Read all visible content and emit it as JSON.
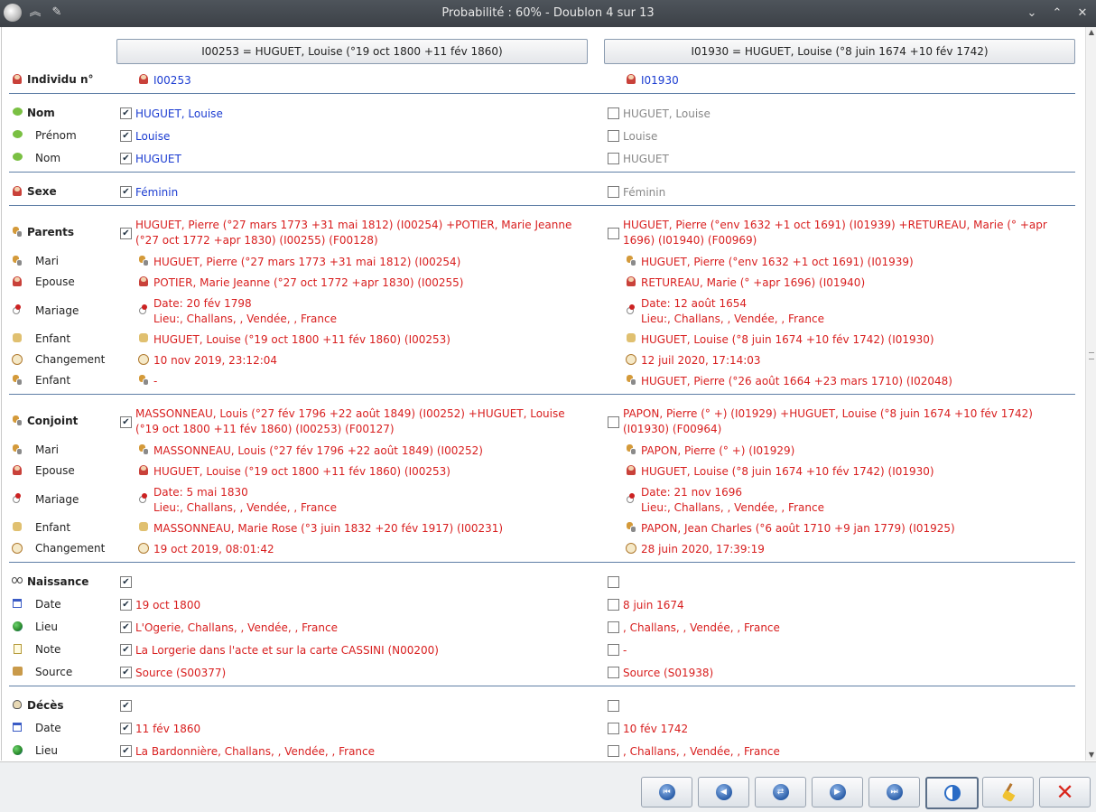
{
  "window": {
    "title": "Probabilité : 60% - Doublon 4 sur 13"
  },
  "header": {
    "left": "I00253 = HUGUET, Louise (°19 oct 1800 +11 fév 1860)",
    "right": "I01930 = HUGUET, Louise (°8 juin 1674 +10 fév 1742)"
  },
  "rows": {
    "individu": {
      "label": "Individu n°",
      "left": "I00253",
      "right": "I01930"
    },
    "nom": {
      "label": "Nom",
      "left": "HUGUET, Louise",
      "right": "HUGUET, Louise"
    },
    "prenom": {
      "label": "Prénom",
      "left": "Louise",
      "right": "Louise"
    },
    "nom2": {
      "label": "Nom",
      "left": "HUGUET",
      "right": "HUGUET"
    },
    "sexe": {
      "label": "Sexe",
      "left": "Féminin",
      "right": "Féminin"
    },
    "parents": {
      "label": "Parents",
      "left": "HUGUET, Pierre (°27 mars 1773 +31 mai 1812) (I00254) +POTIER, Marie Jeanne (°27 oct 1772 +apr 1830) (I00255) (F00128)",
      "right": "HUGUET, Pierre (°env 1632 +1 oct 1691) (I01939) +RETUREAU, Marie (° +apr 1696) (I01940) (F00969)"
    },
    "p_mari": {
      "label": "Mari",
      "left": "HUGUET, Pierre (°27 mars 1773 +31 mai 1812) (I00254)",
      "right": "HUGUET, Pierre (°env 1632 +1 oct 1691) (I01939)"
    },
    "p_epouse": {
      "label": "Epouse",
      "left": "POTIER, Marie Jeanne (°27 oct 1772 +apr 1830) (I00255)",
      "right": "RETUREAU, Marie (° +apr 1696) (I01940)"
    },
    "p_mariage": {
      "label": "Mariage",
      "left1": "Date: 20 fév 1798",
      "left2": "Lieu:, Challans, , Vendée, , France",
      "right1": "Date: 12 août 1654",
      "right2": "Lieu:, Challans, , Vendée, , France"
    },
    "p_enfant": {
      "label": "Enfant",
      "left": "HUGUET, Louise (°19 oct 1800 +11 fév 1860) (I00253)",
      "right": "HUGUET, Louise (°8 juin 1674 +10 fév 1742) (I01930)"
    },
    "p_changement": {
      "label": "Changement",
      "left": "10 nov 2019, 23:12:04",
      "right": "12 juil 2020, 17:14:03"
    },
    "p_enfant2": {
      "label": "Enfant",
      "left": "-",
      "right": "HUGUET, Pierre (°26 août 1664 +23 mars 1710) (I02048)"
    },
    "conjoint": {
      "label": "Conjoint",
      "left": "MASSONNEAU, Louis (°27 fév 1796 +22 août 1849) (I00252) +HUGUET, Louise (°19 oct 1800 +11 fév 1860) (I00253) (F00127)",
      "right": "PAPON, Pierre (° +) (I01929) +HUGUET, Louise (°8 juin 1674 +10 fév 1742) (I01930) (F00964)"
    },
    "c_mari": {
      "label": "Mari",
      "left": "MASSONNEAU, Louis (°27 fév 1796 +22 août 1849) (I00252)",
      "right": "PAPON, Pierre (° +) (I01929)"
    },
    "c_epouse": {
      "label": "Epouse",
      "left": "HUGUET, Louise (°19 oct 1800 +11 fév 1860) (I00253)",
      "right": "HUGUET, Louise (°8 juin 1674 +10 fév 1742) (I01930)"
    },
    "c_mariage": {
      "label": "Mariage",
      "left1": "Date: 5 mai 1830",
      "left2": "Lieu:, Challans, , Vendée, , France",
      "right1": "Date: 21 nov 1696",
      "right2": "Lieu:, Challans, , Vendée, , France"
    },
    "c_enfant": {
      "label": "Enfant",
      "left": "MASSONNEAU, Marie Rose (°3 juin 1832 +20 fév 1917) (I00231)",
      "right": "PAPON, Jean Charles (°6 août 1710 +9 jan 1779) (I01925)"
    },
    "c_changement": {
      "label": "Changement",
      "left": "19 oct 2019, 08:01:42",
      "right": "28 juin 2020, 17:39:19"
    },
    "naissance": {
      "label": "Naissance"
    },
    "n_date": {
      "label": "Date",
      "left": "19 oct 1800",
      "right": "8 juin 1674"
    },
    "n_lieu": {
      "label": "Lieu",
      "left": "L'Ogerie, Challans, , Vendée, , France",
      "right": ", Challans, , Vendée, , France"
    },
    "n_note": {
      "label": "Note",
      "left": "La Lorgerie dans l'acte et sur la carte CASSINI (N00200)",
      "right": "-"
    },
    "n_source": {
      "label": "Source",
      "left": "Source (S00377)",
      "right": "Source (S01938)"
    },
    "deces": {
      "label": "Décès"
    },
    "d_date": {
      "label": "Date",
      "left": "11 fév 1860",
      "right": "10 fév 1742"
    },
    "d_lieu": {
      "label": "Lieu",
      "left": "La Bardonnière, Challans, , Vendée, , France",
      "right": ", Challans, , Vendée, , France"
    }
  },
  "checkmark": "✔",
  "colors": {
    "link": "#1a3bd1",
    "diff": "#d81e1e",
    "disabled": "#888888",
    "separator": "#5f7fa6"
  }
}
